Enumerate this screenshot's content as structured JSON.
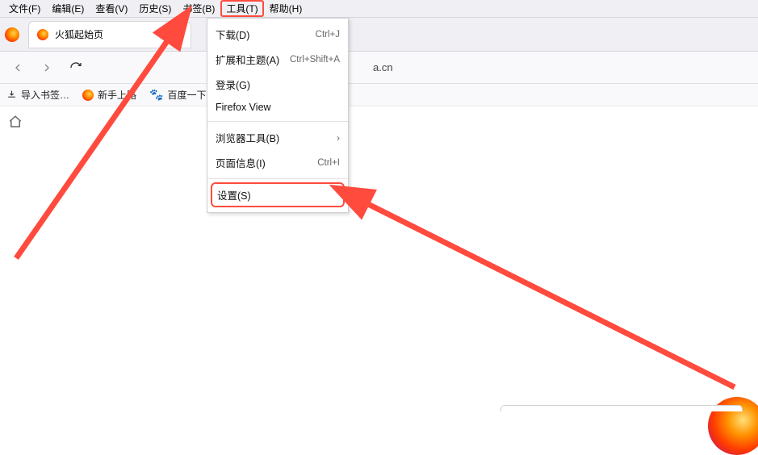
{
  "menubar": {
    "items": [
      {
        "label": "文件(F)"
      },
      {
        "label": "编辑(E)"
      },
      {
        "label": "查看(V)"
      },
      {
        "label": "历史(S)"
      },
      {
        "label": "书签(B)"
      },
      {
        "label": "工具(T)",
        "highlight": true
      },
      {
        "label": "帮助(H)"
      }
    ]
  },
  "tab": {
    "title": "火狐起始页"
  },
  "url_fragment": "a.cn",
  "bookmarks": {
    "import_label": "导入书签…",
    "items": [
      {
        "label": "新手上路",
        "icon": "firefox"
      },
      {
        "label": "百度一下，",
        "icon": "paw"
      }
    ]
  },
  "tools_menu": {
    "items": [
      {
        "label": "下载(D)",
        "shortcut": "Ctrl+J"
      },
      {
        "label": "扩展和主题(A)",
        "shortcut": "Ctrl+Shift+A"
      },
      {
        "label": "登录(G)",
        "shortcut": ""
      },
      {
        "label": "Firefox View",
        "shortcut": ""
      },
      {
        "sep": true
      },
      {
        "label": "浏览器工具(B)",
        "submenu": true
      },
      {
        "label": "页面信息(I)",
        "shortcut": "Ctrl+I"
      },
      {
        "sep": true
      },
      {
        "label": "设置(S)",
        "highlight": true
      }
    ]
  }
}
